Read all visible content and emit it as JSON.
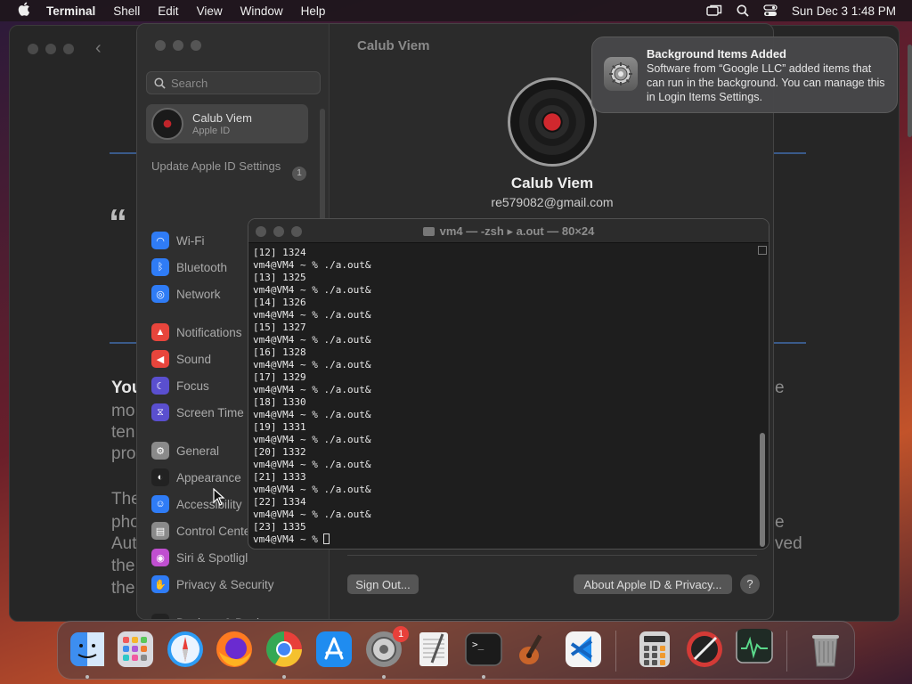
{
  "menubar": {
    "app_name": "Terminal",
    "items": [
      "Shell",
      "Edit",
      "View",
      "Window",
      "Help"
    ],
    "clock": "Sun Dec 3  1:48 PM"
  },
  "background_window": {
    "quote_mark": "“",
    "left_texts": [
      "You",
      "mo",
      "ten",
      "pro",
      "The",
      "pho",
      "Aut",
      "the",
      "the"
    ],
    "right_texts": [
      "e",
      "e",
      "ved"
    ]
  },
  "settings": {
    "search_placeholder": "Search",
    "account_name": "Calub Viem",
    "account_sub": "Apple ID",
    "update_label": "Update Apple ID Settings",
    "update_badge": "1",
    "sidebar_items": [
      {
        "label": "Wi-Fi",
        "icon": "wifi-icon",
        "color": "#2f7cf6"
      },
      {
        "label": "Bluetooth",
        "icon": "bluetooth-icon",
        "color": "#2f7cf6"
      },
      {
        "label": "Network",
        "icon": "globe-icon",
        "color": "#2f7cf6"
      },
      {
        "label": "Notifications",
        "icon": "bell-icon",
        "color": "#e8453c"
      },
      {
        "label": "Sound",
        "icon": "speaker-icon",
        "color": "#e8453c"
      },
      {
        "label": "Focus",
        "icon": "moon-icon",
        "color": "#5a4fcf"
      },
      {
        "label": "Screen Time",
        "icon": "hourglass-icon",
        "color": "#5a4fcf"
      },
      {
        "label": "General",
        "icon": "gear-icon",
        "color": "#8a8a8a"
      },
      {
        "label": "Appearance",
        "icon": "appearance-icon",
        "color": "#222222"
      },
      {
        "label": "Accessibility",
        "icon": "accessibility-icon",
        "color": "#2f7cf6"
      },
      {
        "label": "Control Cente",
        "icon": "control-center-icon",
        "color": "#8a8a8a"
      },
      {
        "label": "Siri & Spotligl",
        "icon": "siri-icon",
        "color": "#c04fd0"
      },
      {
        "label": "Privacy & Security",
        "icon": "hand-icon",
        "color": "#2f7cf6"
      },
      {
        "label": "Desktop & Dock",
        "icon": "dock-icon",
        "color": "#222222"
      }
    ],
    "page_title": "Calub Viem",
    "profile_name": "Calub Viem",
    "profile_email": "re579082@gmail.com",
    "sign_out_label": "Sign Out...",
    "about_label": "About Apple ID & Privacy...",
    "help_label": "?"
  },
  "notification": {
    "title": "Background Items Added",
    "body": "Software from “Google LLC” added items that can run in the background. You can manage this in Login Items Settings."
  },
  "terminal": {
    "title": "vm4 — -zsh ▸ a.out — 80×24",
    "lines": [
      "[12] 1324",
      "vm4@VM4 ~ % ./a.out&",
      "[13] 1325",
      "vm4@VM4 ~ % ./a.out&",
      "[14] 1326",
      "vm4@VM4 ~ % ./a.out&",
      "[15] 1327",
      "vm4@VM4 ~ % ./a.out&",
      "[16] 1328",
      "vm4@VM4 ~ % ./a.out&",
      "[17] 1329",
      "vm4@VM4 ~ % ./a.out&",
      "[18] 1330",
      "vm4@VM4 ~ % ./a.out&",
      "[19] 1331",
      "vm4@VM4 ~ % ./a.out&",
      "[20] 1332",
      "vm4@VM4 ~ % ./a.out&",
      "[21] 1333",
      "vm4@VM4 ~ % ./a.out&",
      "[22] 1334",
      "vm4@VM4 ~ % ./a.out&",
      "[23] 1335"
    ],
    "prompt": "vm4@VM4 ~ % "
  },
  "dock": {
    "apps": [
      {
        "name": "Finder",
        "icon": "finder-icon",
        "color": "#3d8ef0",
        "running": true
      },
      {
        "name": "Launchpad",
        "icon": "launchpad-icon",
        "color": "#d9d9de",
        "running": false
      },
      {
        "name": "Safari",
        "icon": "safari-icon",
        "color": "#2d9cf5",
        "running": false
      },
      {
        "name": "Firefox",
        "icon": "firefox-icon",
        "color": "#ff7b21",
        "running": false
      },
      {
        "name": "Chrome",
        "icon": "chrome-icon",
        "color": "#f2f2f2",
        "running": true
      },
      {
        "name": "App Store",
        "icon": "app-store-icon",
        "color": "#1f8cf0",
        "running": false
      },
      {
        "name": "System Settings",
        "icon": "gear-icon",
        "color": "#8b8b8b",
        "running": true,
        "badge": "1"
      },
      {
        "name": "TextEdit",
        "icon": "textedit-icon",
        "color": "#f1f1f1",
        "running": false
      },
      {
        "name": "Terminal",
        "icon": "terminal-icon",
        "color": "#1b1b1b",
        "running": true
      },
      {
        "name": "GarageBand",
        "icon": "guitar-icon",
        "color": "#3a2a22",
        "running": false
      },
      {
        "name": "VS Code",
        "icon": "vscode-icon",
        "color": "#f4f4f4",
        "running": false
      },
      {
        "name": "Calculator",
        "icon": "calculator-icon",
        "color": "#d5d5d5",
        "running": false
      },
      {
        "name": "Disk Utility",
        "icon": "compass-icon",
        "color": "#d43a36",
        "running": false
      },
      {
        "name": "Activity Monitor",
        "icon": "activity-monitor-icon",
        "color": "#1f2b25",
        "running": false
      },
      {
        "name": "Trash",
        "icon": "trash-icon",
        "color": "#8a8a8a",
        "running": false
      }
    ]
  }
}
